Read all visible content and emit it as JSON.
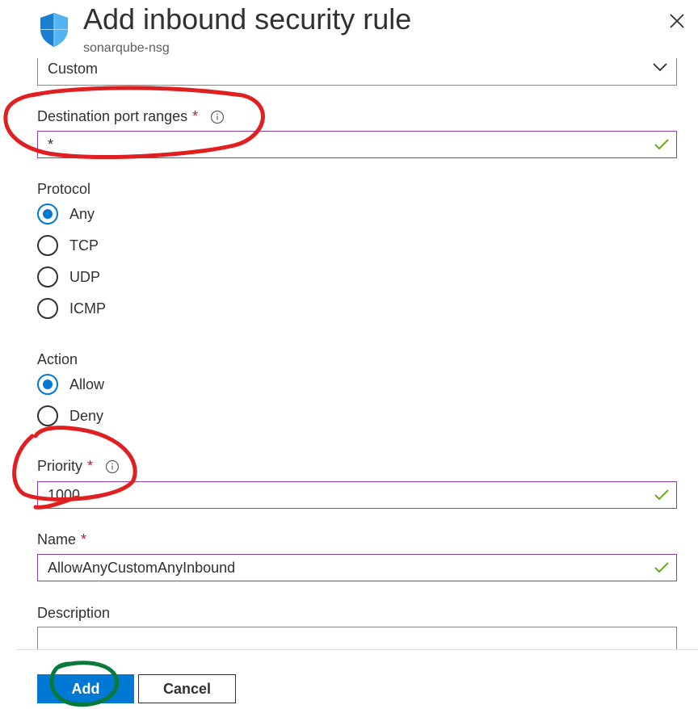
{
  "header": {
    "title": "Add inbound security rule",
    "subtitle": "sonarqube-nsg",
    "icon": "shield-icon",
    "close_icon": "close-icon"
  },
  "form": {
    "dest_port_ranges_service": {
      "value": "Custom"
    },
    "destination_port_ranges": {
      "label": "Destination port ranges",
      "required_mark": "*",
      "value": "*"
    },
    "protocol": {
      "label": "Protocol",
      "options": [
        "Any",
        "TCP",
        "UDP",
        "ICMP"
      ],
      "selected": "Any"
    },
    "action": {
      "label": "Action",
      "options": [
        "Allow",
        "Deny"
      ],
      "selected": "Allow"
    },
    "priority": {
      "label": "Priority",
      "required_mark": "*",
      "value": "1000"
    },
    "name": {
      "label": "Name",
      "required_mark": "*",
      "value": "AllowAnyCustomAnyInbound"
    },
    "description": {
      "label": "Description",
      "value": ""
    }
  },
  "footer": {
    "add_label": "Add",
    "cancel_label": "Cancel"
  },
  "colors": {
    "primary": "#0078d4",
    "required": "#a4262c",
    "valid_border": "#8c3fae",
    "check": "#57a300",
    "annotation_red": "#e02020",
    "annotation_green": "#0a7a3c"
  }
}
